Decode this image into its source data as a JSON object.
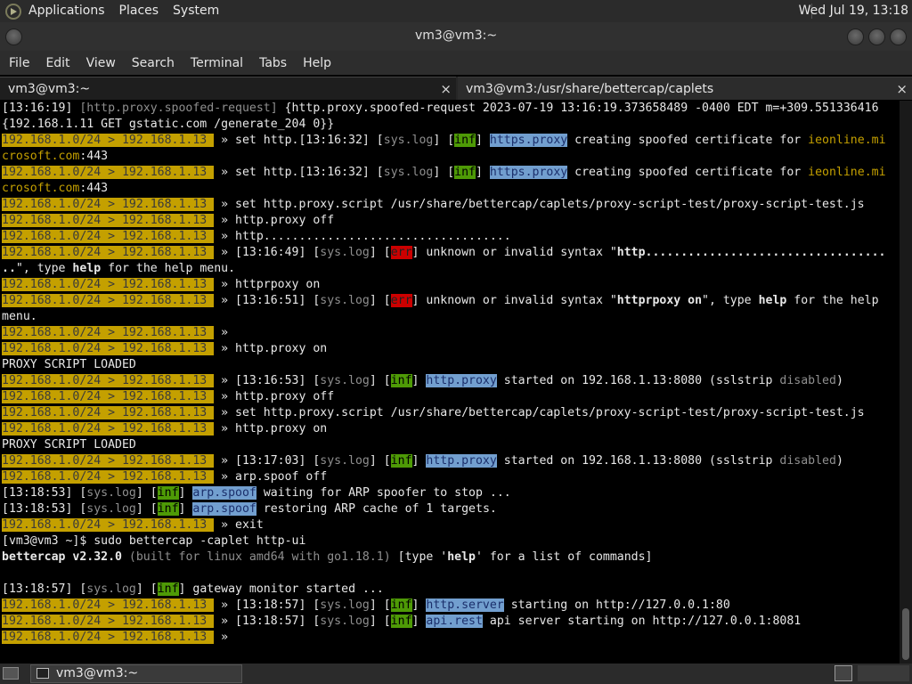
{
  "top_panel": {
    "menus": [
      "Applications",
      "Places",
      "System"
    ],
    "clock": "Wed Jul 19, 13:18"
  },
  "window": {
    "title": "vm3@vm3:~"
  },
  "menubar": [
    "File",
    "Edit",
    "View",
    "Search",
    "Terminal",
    "Tabs",
    "Help"
  ],
  "tabs": [
    {
      "label": "vm3@vm3:~",
      "close": "×"
    },
    {
      "label": "vm3@vm3:/usr/share/bettercap/caplets",
      "close": "×"
    }
  ],
  "prompt": {
    "net": "192.168.1.0/24 > 192.168.1.13 ",
    "arrow": " » "
  },
  "terminal_lines": [
    [
      [
        "[13:16:19] ",
        ""
      ],
      [
        "[http.proxy.spoofed-request]",
        "dim"
      ],
      [
        " {http.proxy.spoofed-request 2023-07-19 13:16:19.373658489 -0400 EDT m=+309.551336416",
        ""
      ]
    ],
    [
      [
        "{192.168.1.11 GET gstatic.com /generate_204 0}}",
        ""
      ]
    ],
    [
      [
        "192.168.1.0/24 > 192.168.1.13 ",
        "ps1"
      ],
      [
        " » set http.[13:16:32] [",
        ""
      ],
      [
        "sys.log",
        "dim"
      ],
      [
        "] [",
        ""
      ],
      [
        "inf",
        "bgg"
      ],
      [
        "] ",
        ""
      ],
      [
        "https.proxy",
        "bgb"
      ],
      [
        " creating spoofed certificate for ",
        ""
      ],
      [
        "ieonline.mi",
        "org"
      ]
    ],
    [
      [
        "crosoft.com",
        "org"
      ],
      [
        ":443",
        ""
      ]
    ],
    [
      [
        "192.168.1.0/24 > 192.168.1.13 ",
        "ps1"
      ],
      [
        " » set http.[13:16:32] [",
        ""
      ],
      [
        "sys.log",
        "dim"
      ],
      [
        "] [",
        ""
      ],
      [
        "inf",
        "bgg"
      ],
      [
        "] ",
        ""
      ],
      [
        "https.proxy",
        "bgb"
      ],
      [
        " creating spoofed certificate for ",
        ""
      ],
      [
        "ieonline.mi",
        "org"
      ]
    ],
    [
      [
        "crosoft.com",
        "org"
      ],
      [
        ":443",
        ""
      ]
    ],
    [
      [
        "192.168.1.0/24 > 192.168.1.13 ",
        "ps1"
      ],
      [
        " » set http.proxy.script /usr/share/bettercap/caplets/proxy-script-test/proxy-script-test.js",
        ""
      ]
    ],
    [
      [
        "192.168.1.0/24 > 192.168.1.13 ",
        "ps1"
      ],
      [
        " » http.proxy off",
        ""
      ]
    ],
    [
      [
        "192.168.1.0/24 > 192.168.1.13 ",
        "ps1"
      ],
      [
        " » http...................................",
        ""
      ]
    ],
    [
      [
        "192.168.1.0/24 > 192.168.1.13 ",
        "ps1"
      ],
      [
        " » [13:16:49] [",
        ""
      ],
      [
        "sys.log",
        "dim"
      ],
      [
        "] [",
        ""
      ],
      [
        "err",
        "bgr"
      ],
      [
        "] unknown or invalid syntax \"",
        ""
      ],
      [
        "http..................................",
        "bold"
      ]
    ],
    [
      [
        "..",
        "bold"
      ],
      [
        "\", type ",
        ""
      ],
      [
        "help",
        "bold"
      ],
      [
        " for the help menu.",
        ""
      ]
    ],
    [
      [
        "192.168.1.0/24 > 192.168.1.13 ",
        "ps1"
      ],
      [
        " » httprpoxy on",
        ""
      ]
    ],
    [
      [
        "192.168.1.0/24 > 192.168.1.13 ",
        "ps1"
      ],
      [
        " » [13:16:51] [",
        ""
      ],
      [
        "sys.log",
        "dim"
      ],
      [
        "] [",
        ""
      ],
      [
        "err",
        "bgr"
      ],
      [
        "] unknown or invalid syntax \"",
        ""
      ],
      [
        "httprpoxy on",
        "bold"
      ],
      [
        "\", type ",
        ""
      ],
      [
        "help",
        "bold"
      ],
      [
        " for the help",
        ""
      ]
    ],
    [
      [
        "menu.",
        ""
      ]
    ],
    [
      [
        "192.168.1.0/24 > 192.168.1.13 ",
        "ps1"
      ],
      [
        " »",
        ""
      ]
    ],
    [
      [
        "192.168.1.0/24 > 192.168.1.13 ",
        "ps1"
      ],
      [
        " » http.proxy on",
        ""
      ]
    ],
    [
      [
        "PROXY SCRIPT LOADED",
        ""
      ]
    ],
    [
      [
        "192.168.1.0/24 > 192.168.1.13 ",
        "ps1"
      ],
      [
        " » [13:16:53] [",
        ""
      ],
      [
        "sys.log",
        "dim"
      ],
      [
        "] [",
        ""
      ],
      [
        "inf",
        "bgg"
      ],
      [
        "] ",
        ""
      ],
      [
        "http.proxy",
        "bgb"
      ],
      [
        " started on 192.168.1.13:8080 (sslstrip ",
        ""
      ],
      [
        "disabled",
        "dim"
      ],
      [
        ")",
        ""
      ]
    ],
    [
      [
        "192.168.1.0/24 > 192.168.1.13 ",
        "ps1"
      ],
      [
        " » http.proxy off",
        ""
      ]
    ],
    [
      [
        "192.168.1.0/24 > 192.168.1.13 ",
        "ps1"
      ],
      [
        " » set http.proxy.script /usr/share/bettercap/caplets/proxy-script-test/proxy-script-test.js",
        ""
      ]
    ],
    [
      [
        "192.168.1.0/24 > 192.168.1.13 ",
        "ps1"
      ],
      [
        " » http.proxy on",
        ""
      ]
    ],
    [
      [
        "PROXY SCRIPT LOADED",
        ""
      ]
    ],
    [
      [
        "192.168.1.0/24 > 192.168.1.13 ",
        "ps1"
      ],
      [
        " » [13:17:03] [",
        ""
      ],
      [
        "sys.log",
        "dim"
      ],
      [
        "] [",
        ""
      ],
      [
        "inf",
        "bgg"
      ],
      [
        "] ",
        ""
      ],
      [
        "http.proxy",
        "bgb"
      ],
      [
        " started on 192.168.1.13:8080 (sslstrip ",
        ""
      ],
      [
        "disabled",
        "dim"
      ],
      [
        ")",
        ""
      ]
    ],
    [
      [
        "192.168.1.0/24 > 192.168.1.13 ",
        "ps1"
      ],
      [
        " » arp.spoof off",
        ""
      ]
    ],
    [
      [
        "[13:18:53] [",
        ""
      ],
      [
        "sys.log",
        "dim"
      ],
      [
        "] [",
        ""
      ],
      [
        "inf",
        "bgg"
      ],
      [
        "] ",
        ""
      ],
      [
        "arp.spoof",
        "bgb"
      ],
      [
        " waiting for ARP spoofer to stop ...",
        ""
      ]
    ],
    [
      [
        "[13:18:53] [",
        ""
      ],
      [
        "sys.log",
        "dim"
      ],
      [
        "] [",
        ""
      ],
      [
        "inf",
        "bgg"
      ],
      [
        "] ",
        ""
      ],
      [
        "arp.spoof",
        "bgb"
      ],
      [
        " restoring ARP cache of 1 targets.",
        ""
      ]
    ],
    [
      [
        "192.168.1.0/24 > 192.168.1.13 ",
        "ps1"
      ],
      [
        " » exit",
        ""
      ]
    ],
    [
      [
        "[vm3@vm3 ~]$ sudo bettercap -caplet http-ui",
        ""
      ]
    ],
    [
      [
        "bettercap v2.32.0",
        "bold"
      ],
      [
        " (built for linux amd64 with go1.18.1)",
        "dim"
      ],
      [
        " [type '",
        ""
      ],
      [
        "help",
        "bold"
      ],
      [
        "' for a list of commands]",
        ""
      ]
    ],
    [
      [
        "",
        ""
      ]
    ],
    [
      [
        "[13:18:57] [",
        ""
      ],
      [
        "sys.log",
        "dim"
      ],
      [
        "] [",
        ""
      ],
      [
        "inf",
        "bgg"
      ],
      [
        "] gateway monitor started ...",
        ""
      ]
    ],
    [
      [
        "192.168.1.0/24 > 192.168.1.13 ",
        "ps1"
      ],
      [
        " » [13:18:57] [",
        ""
      ],
      [
        "sys.log",
        "dim"
      ],
      [
        "] [",
        ""
      ],
      [
        "inf",
        "bgg"
      ],
      [
        "] ",
        ""
      ],
      [
        "http.server",
        "bgb"
      ],
      [
        " starting on http://127.0.0.1:80",
        ""
      ]
    ],
    [
      [
        "192.168.1.0/24 > 192.168.1.13 ",
        "ps1"
      ],
      [
        " » [13:18:57] [",
        ""
      ],
      [
        "sys.log",
        "dim"
      ],
      [
        "] [",
        ""
      ],
      [
        "inf",
        "bgg"
      ],
      [
        "] ",
        ""
      ],
      [
        "api.rest",
        "bgb"
      ],
      [
        " api server starting on http://127.0.0.1:8081",
        ""
      ]
    ],
    [
      [
        "192.168.1.0/24 > 192.168.1.13 ",
        "ps1"
      ],
      [
        " »",
        ""
      ]
    ]
  ],
  "taskbar": {
    "window_label": "vm3@vm3:~"
  },
  "colors": {
    "prompt_bg": "#c4a000",
    "inf_bg": "#4e9a06",
    "err_bg": "#cc0000",
    "module_bg": "#729fcf"
  }
}
